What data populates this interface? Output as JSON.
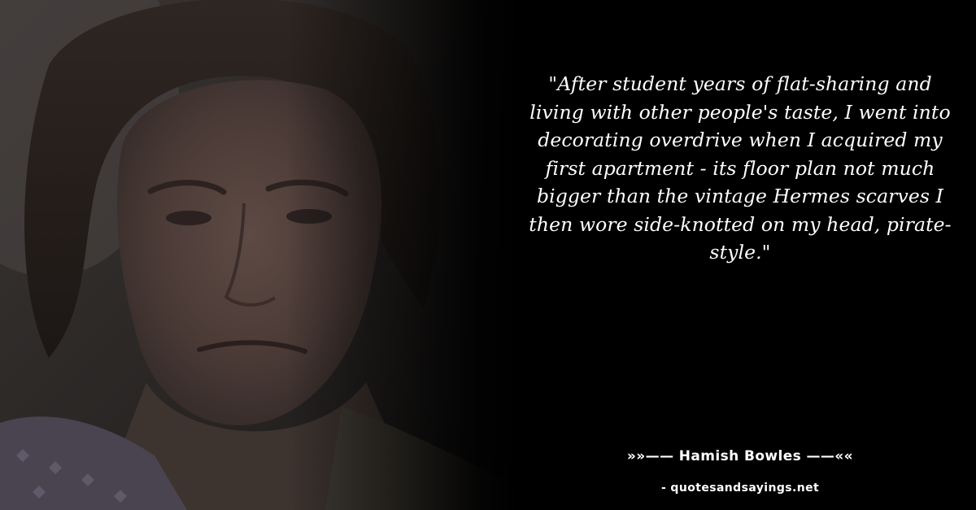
{
  "quote": {
    "text": "\"After student years of flat-sharing and living with other people's taste, I went into decorating overdrive when I acquired my first apartment - its floor plan not much bigger than the vintage Hermes scarves I then wore side-knotted on my head, pirate-style.\"",
    "author": "»»—— Hamish Bowles ——««",
    "source": "- quotesandsayings.net"
  },
  "colors": {
    "background": "#000000",
    "text": "#ffffff"
  }
}
